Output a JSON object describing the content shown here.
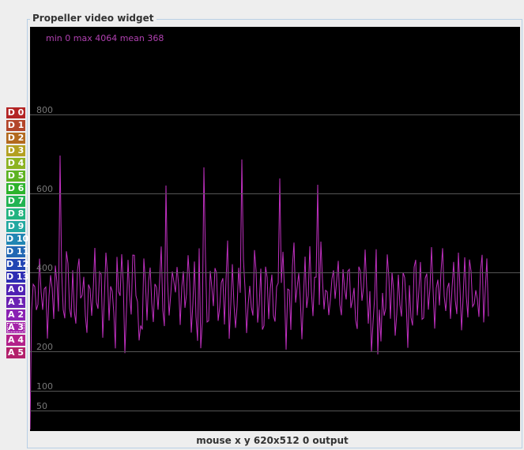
{
  "window": {
    "title": "Propeller  video widget"
  },
  "pins": [
    {
      "label": "D 0",
      "color": "#b32424"
    },
    {
      "label": "D 1",
      "color": "#b3452a"
    },
    {
      "label": "D 2",
      "color": "#b36a1f"
    },
    {
      "label": "D 3",
      "color": "#b3a021"
    },
    {
      "label": "D 4",
      "color": "#8cb321"
    },
    {
      "label": "D 5",
      "color": "#5cb321"
    },
    {
      "label": "D 6",
      "color": "#2bb32b"
    },
    {
      "label": "D 7",
      "color": "#21b352"
    },
    {
      "label": "D 8",
      "color": "#21b380"
    },
    {
      "label": "D 9",
      "color": "#21a8a0"
    },
    {
      "label": "D 10",
      "color": "#2186b3"
    },
    {
      "label": "D 11",
      "color": "#2167b3"
    },
    {
      "label": "D 12",
      "color": "#2145b3"
    },
    {
      "label": "D 13",
      "color": "#2d2db3"
    },
    {
      "label": "A 0",
      "color": "#4f21b3"
    },
    {
      "label": "A 1",
      "color": "#6b21b3"
    },
    {
      "label": "A 2",
      "color": "#8a21b3"
    },
    {
      "label": "A 3",
      "color": "#a321a8",
      "selected": true
    },
    {
      "label": "A 4",
      "color": "#b3218a"
    },
    {
      "label": "A 5",
      "color": "#b3216b"
    }
  ],
  "screen": {
    "stats": "min 0 max 4064 mean 368",
    "trace_color": "#c030c0",
    "grid": [
      {
        "label": "800",
        "value": 800
      },
      {
        "label": "600",
        "value": 600
      },
      {
        "label": "400",
        "value": 400
      },
      {
        "label": "200",
        "value": 200
      },
      {
        "label": "100",
        "value": 100
      },
      {
        "label": "50",
        "value": 50
      }
    ]
  },
  "status": {
    "text": "mouse x y  620x512  0  output"
  }
}
